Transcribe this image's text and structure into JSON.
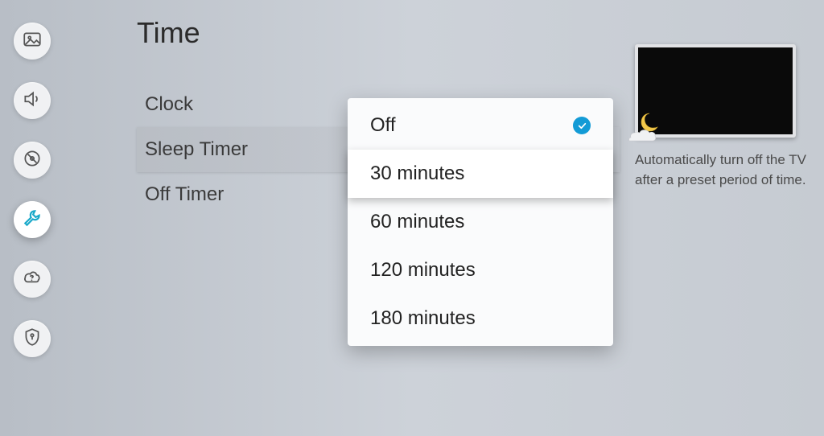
{
  "page": {
    "title": "Time"
  },
  "sidebar": {
    "items": [
      {
        "icon": "picture"
      },
      {
        "icon": "sound"
      },
      {
        "icon": "broadcast"
      },
      {
        "icon": "wrench"
      },
      {
        "icon": "support"
      },
      {
        "icon": "security"
      }
    ],
    "active_index": 3
  },
  "menu": {
    "items": [
      {
        "label": "Clock"
      },
      {
        "label": "Sleep Timer"
      },
      {
        "label": "Off Timer"
      }
    ],
    "selected_index": 1
  },
  "dropdown": {
    "options": [
      {
        "label": "Off"
      },
      {
        "label": "30 minutes"
      },
      {
        "label": "60 minutes"
      },
      {
        "label": "120 minutes"
      },
      {
        "label": "180 minutes"
      }
    ],
    "current_index": 0,
    "highlight_index": 1
  },
  "info": {
    "description": "Automatically turn off the TV after a preset period of time."
  }
}
